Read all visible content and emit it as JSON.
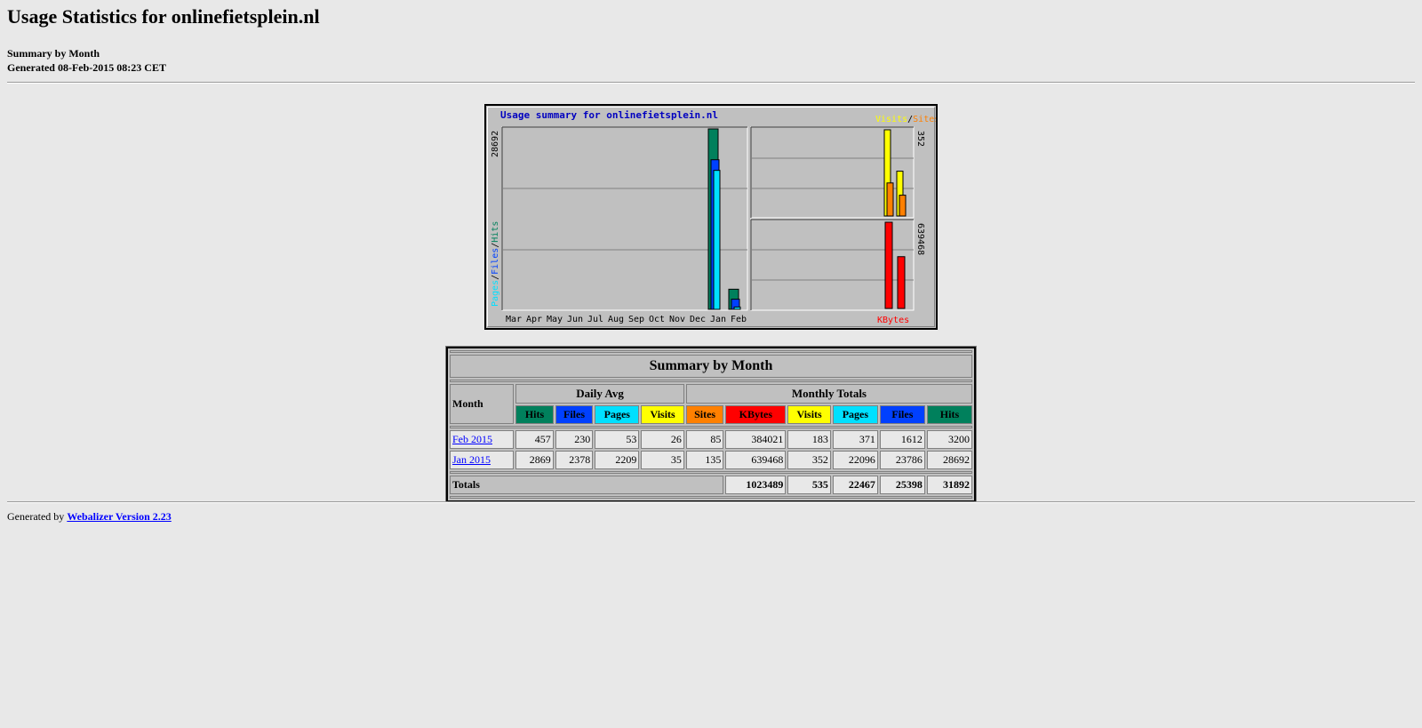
{
  "page": {
    "title": "Usage Statistics for onlinefietsplein.nl",
    "subtitle": "Summary by Month",
    "generated": "Generated 08-Feb-2015 08:23 CET"
  },
  "colors": {
    "hits": "#00805c",
    "files": "#0040ff",
    "pages": "#00e0ff",
    "visits": "#ffff00",
    "sites": "#ff8000",
    "kbytes": "#ff0000"
  },
  "chart_data": {
    "type": "bar",
    "title": "Usage summary for onlinefietsplein.nl",
    "categories": [
      "Mar",
      "Apr",
      "May",
      "Jun",
      "Jul",
      "Aug",
      "Sep",
      "Oct",
      "Nov",
      "Dec",
      "Jan",
      "Feb"
    ],
    "left_axis_label_parts": [
      "Pages",
      "/",
      "Files",
      "/",
      "Hits"
    ],
    "left_axis_max_label": "28692",
    "right_top_max_label": "352",
    "right_bottom_max_label": "639468",
    "top_right_legend_parts": [
      "Visits",
      "/",
      "Sites"
    ],
    "bottom_right_legend": "KBytes",
    "series_main": [
      {
        "name": "Hits",
        "values": [
          0,
          0,
          0,
          0,
          0,
          0,
          0,
          0,
          0,
          0,
          28692,
          3200
        ]
      },
      {
        "name": "Files",
        "values": [
          0,
          0,
          0,
          0,
          0,
          0,
          0,
          0,
          0,
          0,
          23786,
          1612
        ]
      },
      {
        "name": "Pages",
        "values": [
          0,
          0,
          0,
          0,
          0,
          0,
          0,
          0,
          0,
          0,
          22096,
          371
        ]
      }
    ],
    "series_visits_sites": [
      {
        "name": "Visits",
        "values": [
          352,
          183
        ]
      },
      {
        "name": "Sites",
        "values": [
          135,
          85
        ]
      }
    ],
    "series_kbytes": [
      {
        "name": "KBytes",
        "values": [
          639468,
          384021
        ]
      }
    ],
    "ylim_main": [
      0,
      28692
    ],
    "ylim_visits": [
      0,
      352
    ],
    "ylim_kbytes": [
      0,
      639468
    ]
  },
  "table": {
    "title": "Summary by Month",
    "month_header": "Month",
    "daily_avg_header": "Daily Avg",
    "monthly_totals_header": "Monthly Totals",
    "daily_cols": [
      "Hits",
      "Files",
      "Pages",
      "Visits"
    ],
    "monthly_cols": [
      "Sites",
      "KBytes",
      "Visits",
      "Pages",
      "Files",
      "Hits"
    ],
    "rows": [
      {
        "month": "Feb 2015",
        "daily": [
          "457",
          "230",
          "53",
          "26"
        ],
        "monthly": [
          "85",
          "384021",
          "183",
          "371",
          "1612",
          "3200"
        ]
      },
      {
        "month": "Jan 2015",
        "daily": [
          "2869",
          "2378",
          "2209",
          "35"
        ],
        "monthly": [
          "135",
          "639468",
          "352",
          "22096",
          "23786",
          "28692"
        ]
      }
    ],
    "totals_label": "Totals",
    "totals": [
      "1023489",
      "535",
      "22467",
      "25398",
      "31892"
    ]
  },
  "footer": {
    "prefix": "Generated by",
    "link": "Webalizer Version 2.23"
  }
}
